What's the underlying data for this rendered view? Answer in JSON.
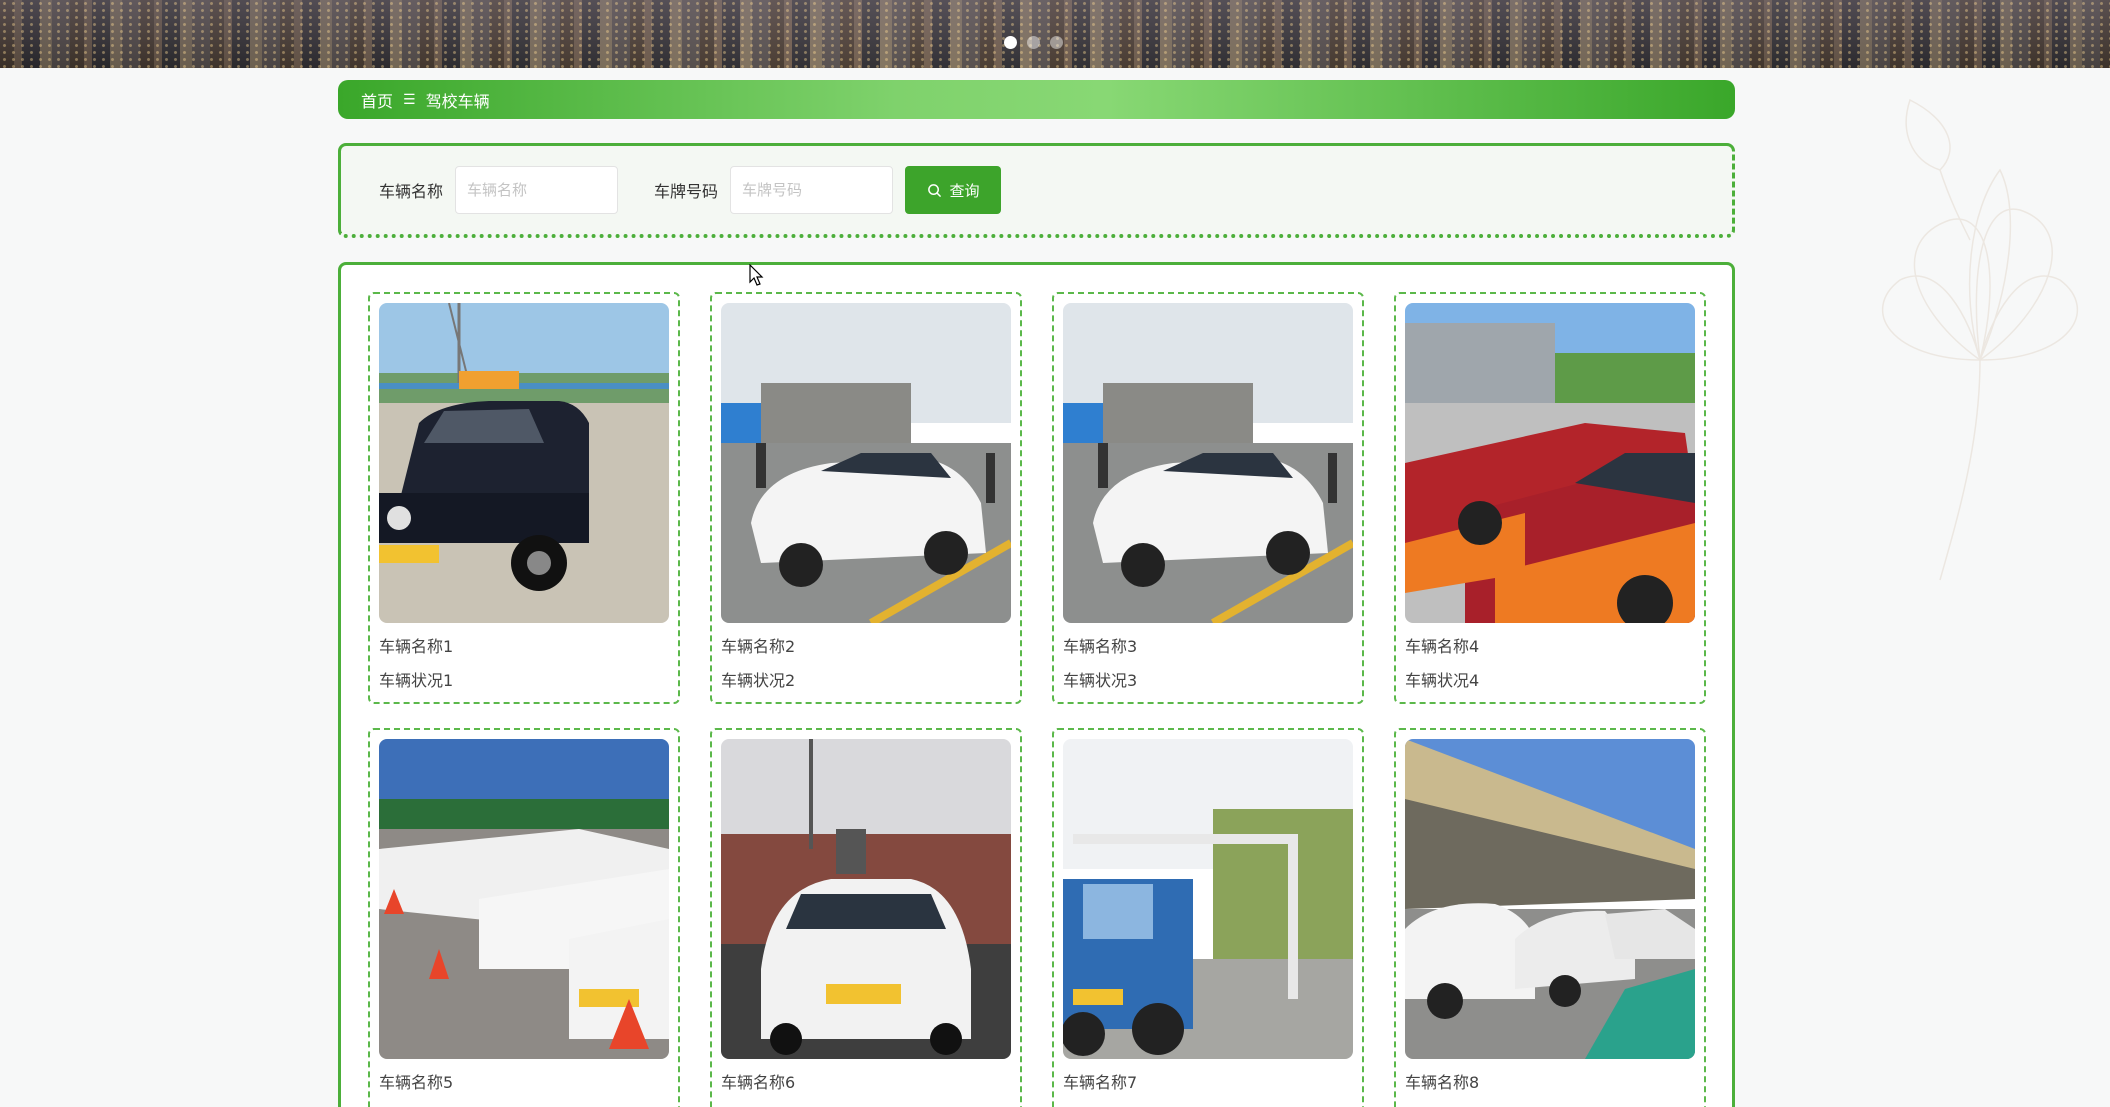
{
  "breadcrumb": {
    "home": "首页",
    "separator": "☰",
    "current": "驾校车辆"
  },
  "search": {
    "name_label": "车辆名称",
    "name_placeholder": "车辆名称",
    "plate_label": "车牌号码",
    "plate_placeholder": "车牌号码",
    "button_label": "查询",
    "button_icon": "search-icon"
  },
  "carousel": {
    "slides": 3,
    "active_index": 0
  },
  "colors": {
    "accent": "#3da42b",
    "border": "#4caf3a"
  },
  "vehicles": [
    {
      "name": "车辆名称1",
      "status": "车辆状况1"
    },
    {
      "name": "车辆名称2",
      "status": "车辆状况2"
    },
    {
      "name": "车辆名称3",
      "status": "车辆状况3"
    },
    {
      "name": "车辆名称4",
      "status": "车辆状况4"
    },
    {
      "name": "车辆名称5",
      "status": ""
    },
    {
      "name": "车辆名称6",
      "status": ""
    },
    {
      "name": "车辆名称7",
      "status": ""
    },
    {
      "name": "车辆名称8",
      "status": ""
    }
  ]
}
